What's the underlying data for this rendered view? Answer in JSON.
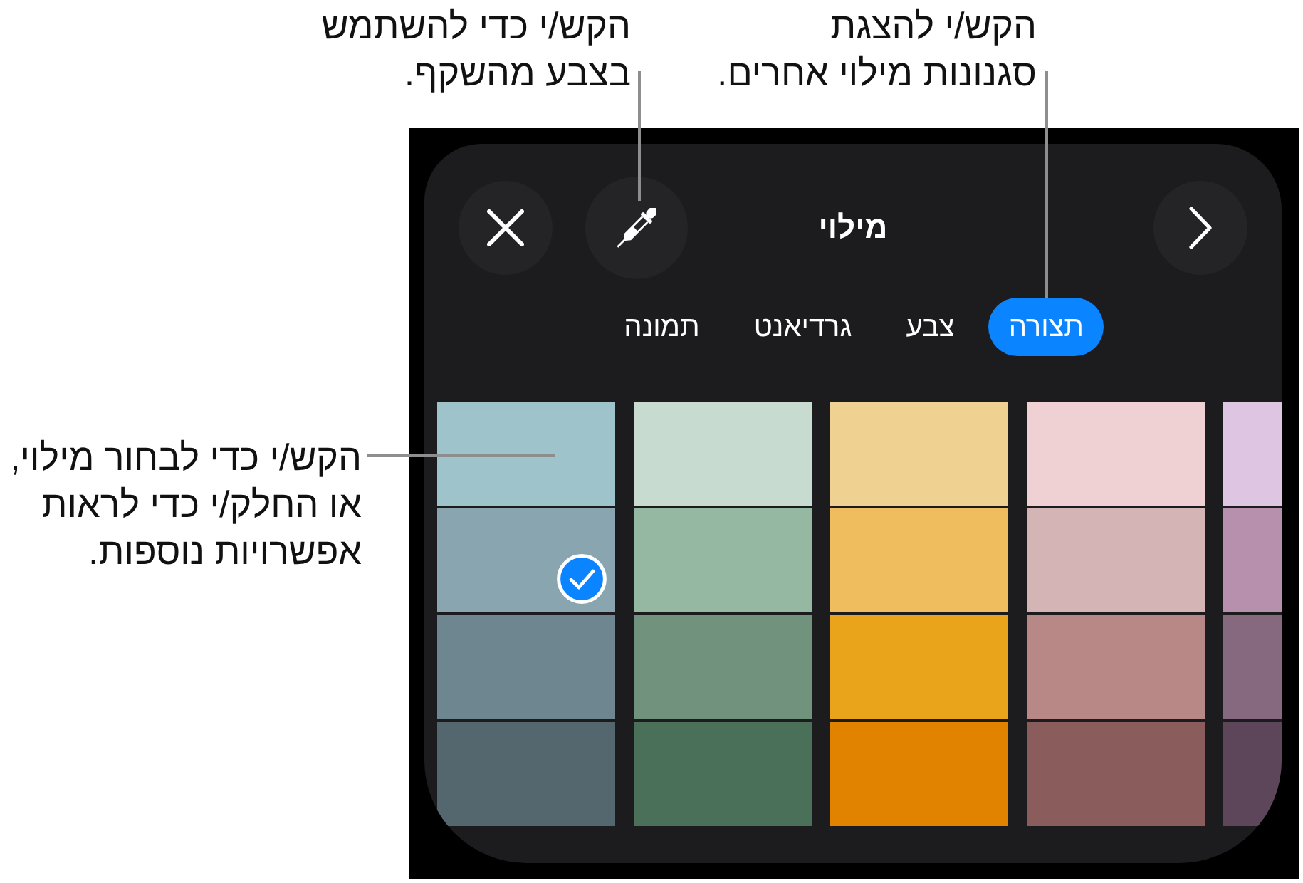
{
  "top_callouts": [
    {
      "text": "הקש/י להצגת\nסגנונות מילוי אחרים."
    },
    {
      "text": "הקש/י כדי להשתמש\nבצבע מהשקף."
    }
  ],
  "side_callout": {
    "text": "הקש/י כדי לבחור מילוי,\nאו החלק/י כדי לראות\nאפשרויות נוספות."
  },
  "panel": {
    "title": "מילוי",
    "tabs": [
      {
        "label": "תצורה",
        "selected": true
      },
      {
        "label": "צבע",
        "selected": false
      },
      {
        "label": "גרדיאנט",
        "selected": false
      },
      {
        "label": "תמונה",
        "selected": false
      }
    ],
    "swatch_columns": [
      {
        "swatches": [
          {
            "color": "#9fc3cb",
            "selected": false
          },
          {
            "color": "#88a5b0",
            "selected": true
          },
          {
            "color": "#6e8690",
            "selected": false
          },
          {
            "color": "#54666e",
            "selected": false
          }
        ]
      },
      {
        "swatches": [
          {
            "color": "#c7dbd0",
            "selected": false
          },
          {
            "color": "#94b8a2",
            "selected": false
          },
          {
            "color": "#71937d",
            "selected": false
          },
          {
            "color": "#4a705a",
            "selected": false
          }
        ]
      },
      {
        "swatches": [
          {
            "color": "#efd291",
            "selected": false
          },
          {
            "color": "#efbd5e",
            "selected": false
          },
          {
            "color": "#e9a41c",
            "selected": false
          },
          {
            "color": "#e28300",
            "selected": false
          }
        ]
      },
      {
        "swatches": [
          {
            "color": "#efd1d3",
            "selected": false
          },
          {
            "color": "#d5b4b6",
            "selected": false
          },
          {
            "color": "#b88886",
            "selected": false
          },
          {
            "color": "#8a5c5c",
            "selected": false
          }
        ]
      },
      {
        "swatches": [
          {
            "color": "#dec6e2",
            "selected": false
          },
          {
            "color": "#b690ad",
            "selected": false
          },
          {
            "color": "#86697e",
            "selected": false
          },
          {
            "color": "#5d4659",
            "selected": false
          }
        ]
      }
    ]
  }
}
